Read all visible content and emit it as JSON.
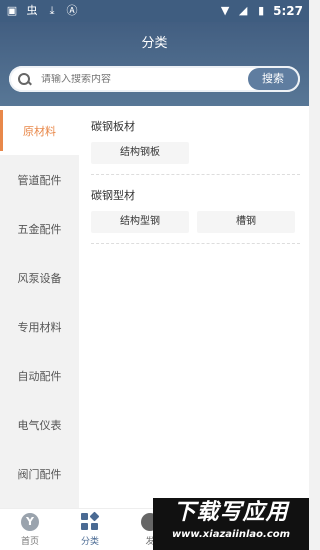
{
  "status_bar": {
    "icons": [
      "image-icon",
      "bug-icon",
      "download-icon",
      "a-box-icon"
    ],
    "right_icons": [
      "wifi-icon",
      "signal-icon",
      "battery-icon"
    ],
    "time": "5:27"
  },
  "header": {
    "title": "分类"
  },
  "search": {
    "placeholder": "请输入搜索内容",
    "button_label": "搜索"
  },
  "sidebar": {
    "items": [
      {
        "label": "原材料",
        "active": true
      },
      {
        "label": "管道配件"
      },
      {
        "label": "五金配件"
      },
      {
        "label": "风泵设备"
      },
      {
        "label": "专用材料"
      },
      {
        "label": "自动配件"
      },
      {
        "label": "电气仪表"
      },
      {
        "label": "阀门配件"
      }
    ]
  },
  "main": {
    "groups": [
      {
        "title": "碳钢板材",
        "tags": [
          "结构钢板"
        ]
      },
      {
        "title": "碳钢型材",
        "tags": [
          "结构型钢",
          "槽钢"
        ]
      }
    ]
  },
  "tabbar": {
    "tabs": [
      {
        "label": "首页",
        "icon": "home-icon"
      },
      {
        "label": "分类",
        "icon": "category-icon",
        "active": true
      },
      {
        "label": "发",
        "icon": "publish-icon"
      }
    ]
  },
  "watermark": {
    "main": "下载写应用",
    "url": "www.xiazaiinlao.com"
  }
}
